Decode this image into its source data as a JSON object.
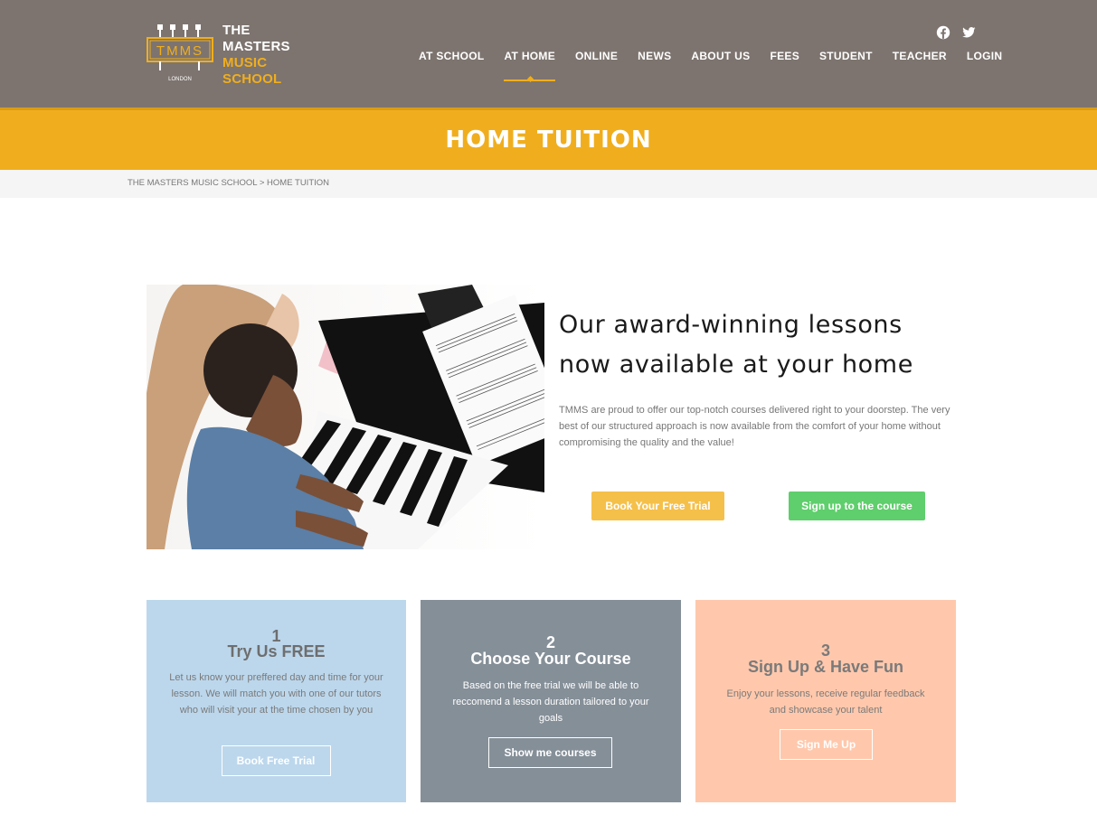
{
  "brand": {
    "mark": "TMMS",
    "mark_sub": "LONDON",
    "line1": "THE",
    "line2": "MASTERS",
    "line3": "MUSIC",
    "line4": "SCHOOL"
  },
  "social": {
    "icons": [
      "facebook-icon",
      "twitter-icon"
    ]
  },
  "nav": {
    "items": [
      {
        "label": "AT SCHOOL"
      },
      {
        "label": "AT HOME",
        "active": true
      },
      {
        "label": "ONLINE"
      },
      {
        "label": "NEWS"
      },
      {
        "label": "ABOUT US"
      },
      {
        "label": "FEES"
      },
      {
        "label": "STUDENT"
      },
      {
        "label": "TEACHER"
      },
      {
        "label": "LOGIN"
      }
    ]
  },
  "page": {
    "title": "HOME TUITION",
    "breadcrumb": "THE MASTERS MUSIC SCHOOL > HOME TUITION"
  },
  "hero": {
    "heading_line1": "Our award-winning lessons",
    "heading_line2": "now available at your home",
    "text": "TMMS are proud to offer our top-notch courses delivered right to your doorstep. The very best of our structured approach is now available from the comfort of your home without compromising  the quality and the value!",
    "btn_trial": "Book Your Free Trial",
    "btn_signup": "Sign up to the course"
  },
  "steps": [
    {
      "num": "1",
      "title": "Try Us FREE",
      "desc": "Let us know your preffered day and time for your lesson. We will match you with one of our tutors who will visit your at the time chosen by you",
      "button": "Book Free Trial"
    },
    {
      "num": "2",
      "title": "Choose Your Course",
      "desc": "Based on the free trial we will be able to reccomend a lesson duration tailored to your goals",
      "button": "Show me courses"
    },
    {
      "num": "3",
      "title": "Sign Up & Have Fun",
      "desc": "Enjoy your lessons, receive regular feedback and showcase your talent",
      "button": "Sign Me Up"
    }
  ],
  "colors": {
    "header_bg": "#7d746f",
    "accent": "#f0ae1e",
    "card1": "#bcd7ec",
    "card2": "#858f98",
    "card3": "#ffc8ac",
    "btn_trial": "#f5c04a",
    "btn_signup": "#5fce6c"
  }
}
